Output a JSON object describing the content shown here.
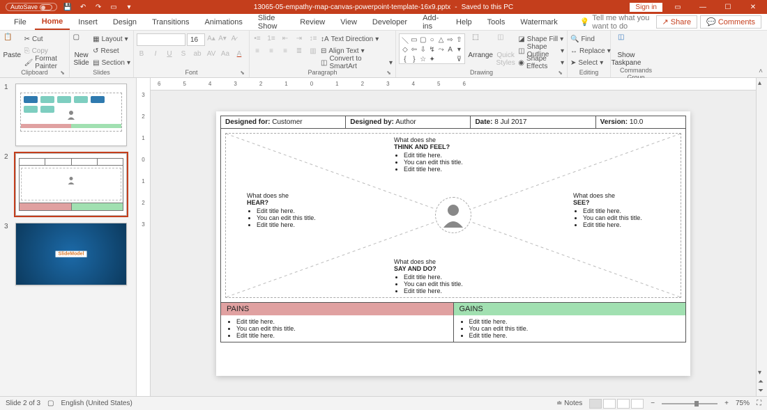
{
  "titlebar": {
    "autosave_label": "AutoSave",
    "autosave_state": "Off",
    "filename": "13065-05-empathy-map-canvas-powerpoint-template-16x9.pptx",
    "save_state": "Saved to this PC",
    "signin": "Sign in"
  },
  "menu": {
    "tabs": [
      "File",
      "Home",
      "Insert",
      "Design",
      "Transitions",
      "Animations",
      "Slide Show",
      "Review",
      "View",
      "Developer",
      "Add-ins",
      "Help",
      "Tools",
      "Watermark"
    ],
    "tellme_placeholder": "Tell me what you want to do",
    "share": "Share",
    "comments": "Comments"
  },
  "ribbon": {
    "clipboard": {
      "paste": "Paste",
      "cut": "Cut",
      "copy": "Copy",
      "fp": "Format Painter",
      "label": "Clipboard"
    },
    "slides": {
      "new": "New\nSlide",
      "layout": "Layout",
      "reset": "Reset",
      "section": "Section",
      "label": "Slides"
    },
    "font": {
      "size": "16",
      "label": "Font"
    },
    "paragraph": {
      "td": "Text Direction",
      "at": "Align Text",
      "cs": "Convert to SmartArt",
      "label": "Paragraph"
    },
    "drawing": {
      "arrange": "Arrange",
      "quick": "Quick\nStyles",
      "sf": "Shape Fill",
      "so": "Shape Outline",
      "se": "Shape Effects",
      "label": "Drawing"
    },
    "editing": {
      "find": "Find",
      "replace": "Replace",
      "select": "Select",
      "label": "Editing"
    },
    "commands": {
      "show": "Show\nTaskpane",
      "label": "Commands Group"
    }
  },
  "ruler_h": [
    "6",
    "5",
    "4",
    "3",
    "2",
    "1",
    "0",
    "1",
    "2",
    "3",
    "4",
    "5",
    "6"
  ],
  "ruler_v": [
    "",
    "3",
    "2",
    "1",
    "0",
    "1",
    "2",
    "3"
  ],
  "thumbs": {
    "n1": "1",
    "n2": "2",
    "n3": "3",
    "logo": "SlideModel"
  },
  "slide": {
    "h1_label": "Designed for:",
    "h1_val": "Customer",
    "h2_label": "Designed by:",
    "h2_val": "Author",
    "h3_label": "Date:",
    "h3_val": "8 Jul 2017",
    "h4_label": "Version:",
    "h4_val": "10.0",
    "q_prefix": "What does she",
    "q_think": "THINK AND FEEL?",
    "q_hear": "HEAR?",
    "q_see": "SEE?",
    "q_say": "SAY AND DO?",
    "bul1": "Edit title here.",
    "bul2": "You can edit this title.",
    "bul3": "Edit title here.",
    "pains": "PAINS",
    "gains": "GAINS"
  },
  "status": {
    "slide_info": "Slide 2 of 3",
    "lang": "English (United States)",
    "notes": "Notes",
    "zoom": "75%"
  }
}
